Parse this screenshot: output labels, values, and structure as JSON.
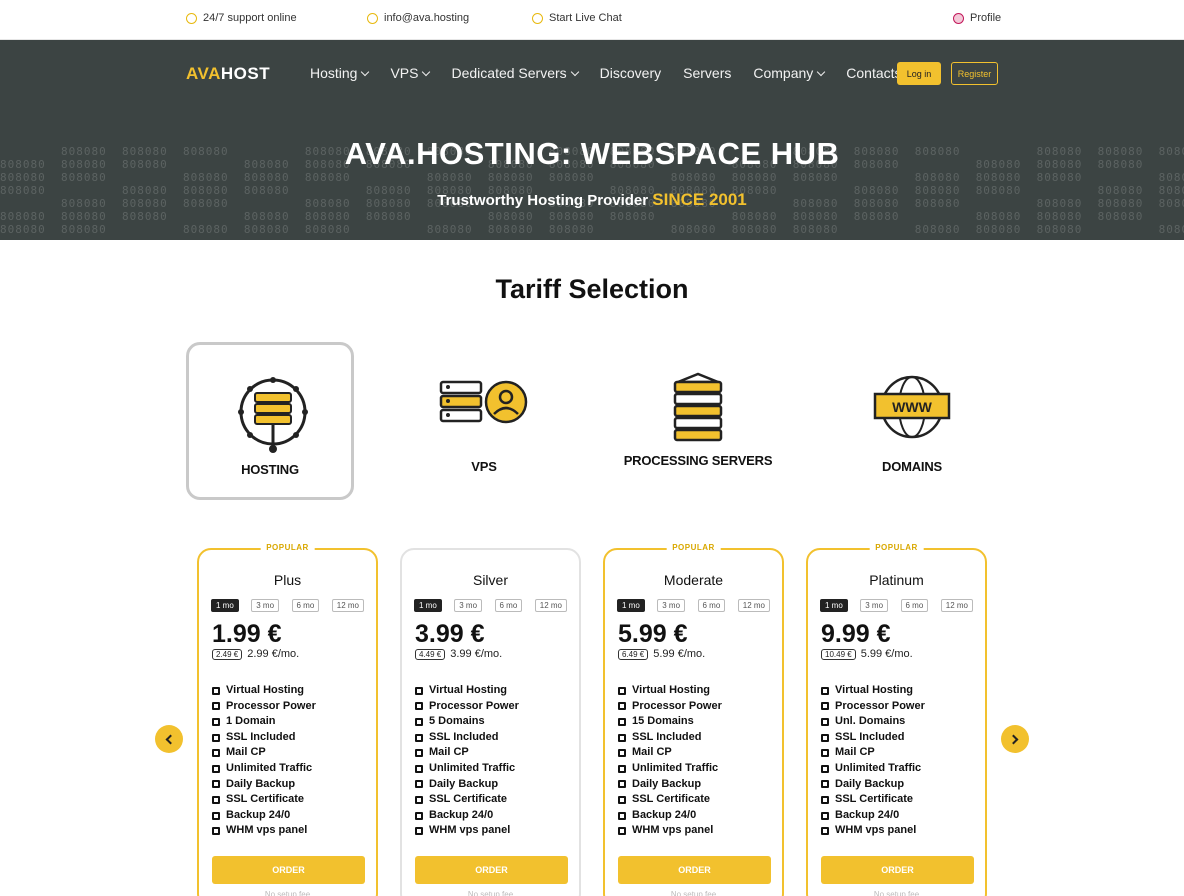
{
  "topbar": {
    "items": [
      {
        "label": "24/7 support online",
        "icon": "clock-icon"
      },
      {
        "label": "info@ava.hosting",
        "icon": "mail-icon"
      },
      {
        "label": "Start Live Chat",
        "icon": "chat-icon"
      },
      {
        "label": "Profile",
        "icon": "user-icon"
      }
    ]
  },
  "header": {
    "logo_mark": "AVA",
    "logo_text": "HOST",
    "nav": [
      {
        "label": "Hosting",
        "dropdown": true
      },
      {
        "label": "VPS",
        "dropdown": true
      },
      {
        "label": "Dedicated Servers",
        "dropdown": true
      },
      {
        "label": "Discovery",
        "dropdown": false
      },
      {
        "label": "Servers",
        "dropdown": false
      },
      {
        "label": "Company",
        "dropdown": true
      },
      {
        "label": "Contacts",
        "dropdown": false
      }
    ],
    "login_label": "Log in",
    "register_label": "Register"
  },
  "hero": {
    "title": "AVA.HOSTING: WEBSPACE HUB",
    "subtitle": "Trustworthy Hosting Provider",
    "since": "SINCE 2001"
  },
  "tariffs": {
    "title": "Tariff Selection",
    "categories": [
      {
        "label": "HOSTING",
        "icon": "hosting-server-icon",
        "active": true
      },
      {
        "label": "VPS",
        "icon": "vps-user-icon",
        "active": false
      },
      {
        "label": "PROCESSING SERVERS",
        "icon": "server-stack-icon",
        "active": false
      },
      {
        "label": "DOMAINS",
        "icon": "www-globe-icon",
        "active": false
      }
    ],
    "periods": [
      "1 mo",
      "3 mo",
      "6 mo",
      "12 mo"
    ],
    "plans": [
      {
        "ribbon": "POPULAR",
        "name": "Plus",
        "price": "1.99 €",
        "old_price": "2.49 €",
        "price_sub": "2.99 €/mo.",
        "features": [
          "Virtual Hosting",
          "Processor Power",
          "1 Domain",
          "SSL Included",
          "Mail CP",
          "Unlimited Traffic",
          "Daily Backup",
          "SSL Certificate",
          "Backup 24/0",
          "WHM vps panel"
        ],
        "order_label": "ORDER",
        "footnote": "No setup fee",
        "highlight": true
      },
      {
        "ribbon": "",
        "name": "Silver",
        "price": "3.99 €",
        "old_price": "4.49 €",
        "price_sub": "3.99 €/mo.",
        "features": [
          "Virtual Hosting",
          "Processor Power",
          "5 Domains",
          "SSL Included",
          "Mail CP",
          "Unlimited Traffic",
          "Daily Backup",
          "SSL Certificate",
          "Backup 24/0",
          "WHM vps panel"
        ],
        "order_label": "ORDER",
        "footnote": "No setup fee",
        "highlight": false
      },
      {
        "ribbon": "POPULAR",
        "name": "Moderate",
        "price": "5.99 €",
        "old_price": "6.49 €",
        "price_sub": "5.99 €/mo.",
        "features": [
          "Virtual Hosting",
          "Processor Power",
          "15 Domains",
          "SSL Included",
          "Mail CP",
          "Unlimited Traffic",
          "Daily Backup",
          "SSL Certificate",
          "Backup 24/0",
          "WHM vps panel"
        ],
        "order_label": "ORDER",
        "footnote": "No setup fee",
        "highlight": true
      },
      {
        "ribbon": "POPULAR",
        "name": "Platinum",
        "price": "9.99 €",
        "old_price": "10.49 €",
        "price_sub": "5.99 €/mo.",
        "features": [
          "Virtual Hosting",
          "Processor Power",
          "Unl. Domains",
          "SSL Included",
          "Mail CP",
          "Unlimited Traffic",
          "Daily Backup",
          "SSL Certificate",
          "Backup 24/0",
          "WHM vps panel"
        ],
        "order_label": "ORDER",
        "footnote": "No setup fee",
        "highlight": true
      }
    ]
  },
  "colors": {
    "accent": "#f2c12e",
    "header_bg": "#3c4443",
    "page_bg": "#ffffff"
  }
}
